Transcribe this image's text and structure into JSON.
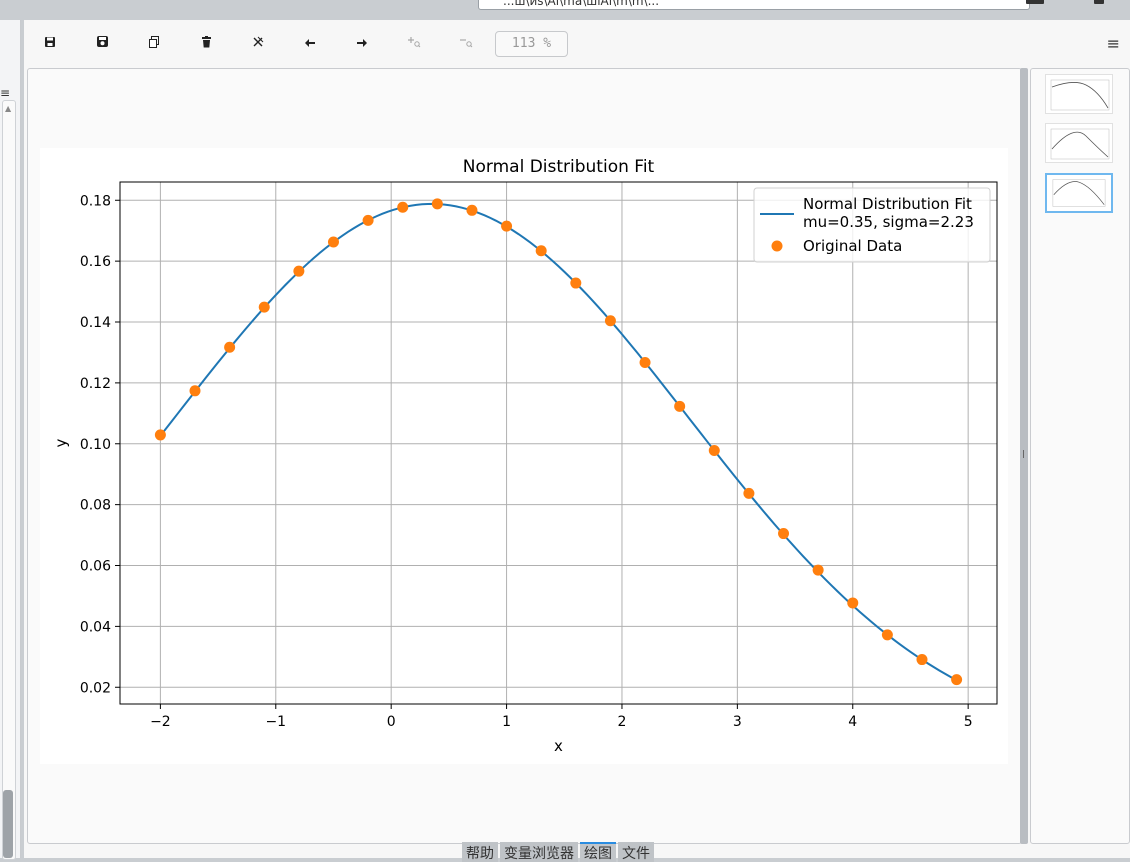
{
  "window": {
    "path_text": "...ш\\иs\\Ai\\ma\\шiAi\\m\\m\\...",
    "top_icon_color": "#333333"
  },
  "toolbar": {
    "buttons": [
      {
        "name": "save-icon",
        "glyph": "🖫",
        "enabled": true
      },
      {
        "name": "save-all-icon",
        "glyph": "🖪",
        "enabled": true
      },
      {
        "name": "copy-icon",
        "glyph": "⧉",
        "enabled": true
      },
      {
        "name": "delete-icon",
        "glyph": "🗑",
        "enabled": true
      },
      {
        "name": "delete-all-icon",
        "glyph": "✕",
        "enabled": true
      },
      {
        "name": "arrow-left-icon",
        "glyph": "←",
        "enabled": true
      },
      {
        "name": "arrow-right-icon",
        "glyph": "→",
        "enabled": true
      },
      {
        "name": "zoom-in-icon",
        "glyph": "+",
        "enabled": false
      },
      {
        "name": "zoom-out-icon",
        "glyph": "−",
        "enabled": false
      }
    ],
    "zoom_value": "113 %",
    "menu_glyph": "≡"
  },
  "tabs": {
    "items": [
      {
        "label": "帮助",
        "active": false
      },
      {
        "label": "变量浏览器",
        "active": false
      },
      {
        "label": "绘图",
        "active": true
      },
      {
        "label": "文件",
        "active": false
      }
    ],
    "accent": "#2a8ce0"
  },
  "thumbnails": {
    "count": 3,
    "active_index": 2
  },
  "colors": {
    "line": "#1f77b4",
    "points": "#ff7f0e",
    "thumb_active": "#6fb8ef"
  },
  "chart_data": {
    "type": "line",
    "title": "Normal Distribution Fit",
    "xlabel": "x",
    "ylabel": "y",
    "xlim": [
      -2.35,
      5.25
    ],
    "ylim": [
      0.0145,
      0.186
    ],
    "xticks": [
      -2,
      -1,
      0,
      1,
      2,
      3,
      4,
      5
    ],
    "xtick_labels": [
      "−2",
      "−1",
      "0",
      "1",
      "2",
      "3",
      "4",
      "5"
    ],
    "yticks": [
      0.02,
      0.04,
      0.06,
      0.08,
      0.1,
      0.12,
      0.14,
      0.16,
      0.18
    ],
    "ytick_labels": [
      "0.02",
      "0.04",
      "0.06",
      "0.08",
      "0.10",
      "0.12",
      "0.14",
      "0.16",
      "0.18"
    ],
    "grid": true,
    "legend_position": "top-right",
    "series": [
      {
        "name": "Normal Distribution Fit\nmu=0.35, sigma=2.23",
        "kind": "line",
        "mu": 0.35,
        "sigma": 2.23,
        "x_range": [
          -2,
          4.9
        ]
      },
      {
        "name": "Original Data",
        "kind": "scatter",
        "x": [
          -2.0,
          -1.7,
          -1.4,
          -1.1,
          -0.8,
          -0.5,
          -0.2,
          0.1,
          0.4,
          0.7,
          1.0,
          1.3,
          1.6,
          1.9,
          2.2,
          2.5,
          2.8,
          3.1,
          3.4,
          3.7,
          4.0,
          4.3,
          4.6,
          4.9
        ],
        "y": [
          0.1029,
          0.1174,
          0.1317,
          0.1449,
          0.1567,
          0.1663,
          0.1734,
          0.1777,
          0.1788,
          0.1767,
          0.1715,
          0.1634,
          0.1528,
          0.1404,
          0.1267,
          0.1123,
          0.0978,
          0.0837,
          0.0705,
          0.0585,
          0.0477,
          0.0372,
          0.0291,
          0.0225
        ]
      }
    ]
  }
}
